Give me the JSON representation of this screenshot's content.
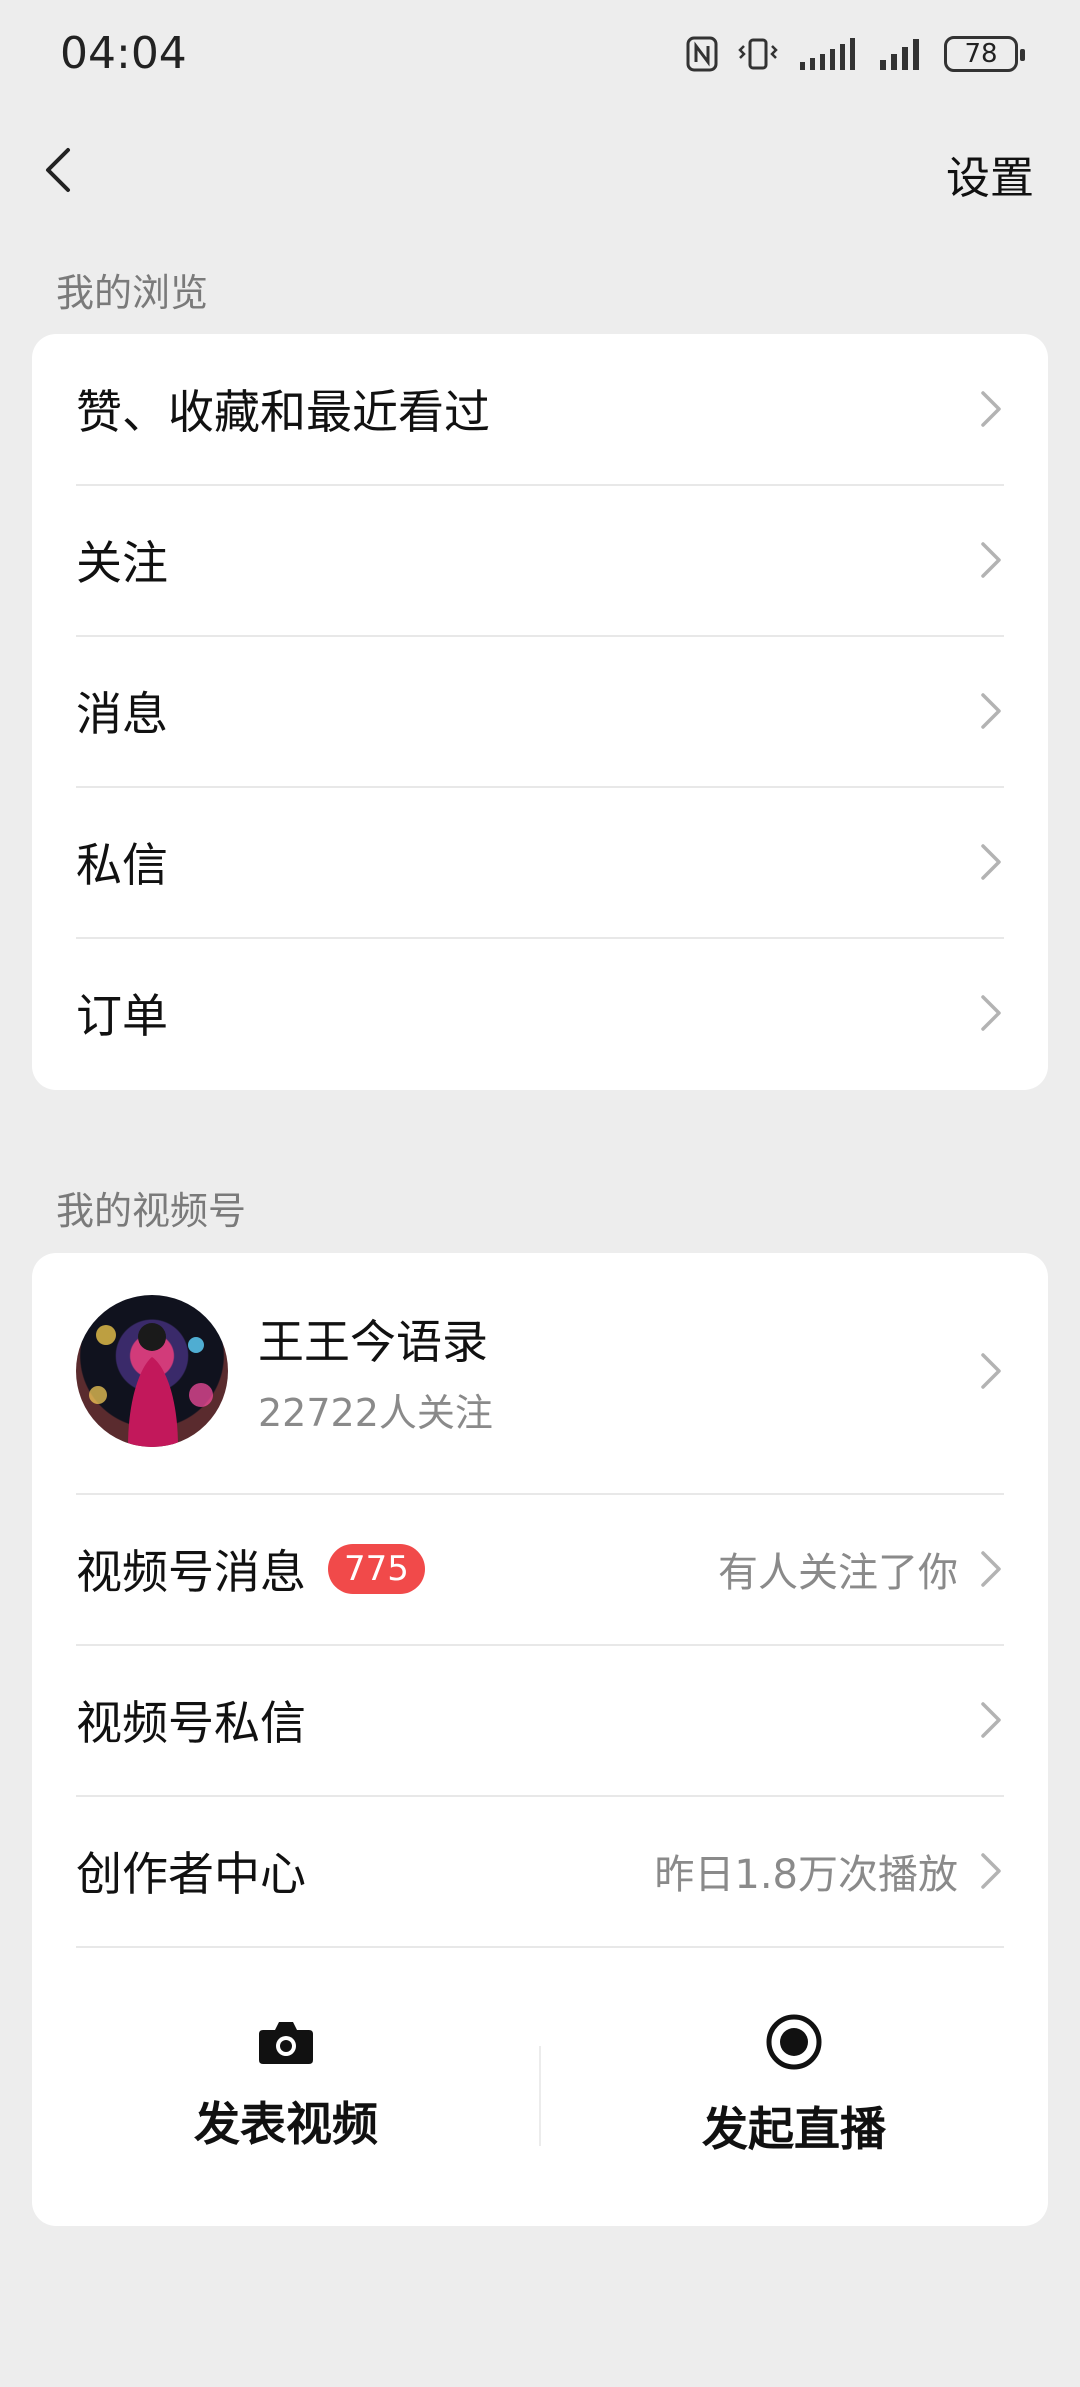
{
  "status_bar": {
    "time": "04:04",
    "battery": "78"
  },
  "nav": {
    "settings_label": "设置"
  },
  "browsing": {
    "title": "我的浏览",
    "items": [
      {
        "label": "赞、收藏和最近看过"
      },
      {
        "label": "关注"
      },
      {
        "label": "消息"
      },
      {
        "label": "私信"
      },
      {
        "label": "订单"
      }
    ]
  },
  "channels": {
    "title": "我的视频号",
    "profile": {
      "name": "王王今语录",
      "followers": "22722人关注"
    },
    "messages": {
      "label": "视频号消息",
      "badge": "775",
      "sub": "有人关注了你"
    },
    "dm": {
      "label": "视频号私信"
    },
    "creator": {
      "label": "创作者中心",
      "sub": "昨日1.8万次播放"
    },
    "actions": {
      "post_video": "发表视频",
      "start_live": "发起直播"
    }
  },
  "icons": {
    "back": "chevron-left-icon",
    "chevron": "chevron-right-icon",
    "camera": "camera-icon",
    "live": "live-record-icon"
  }
}
